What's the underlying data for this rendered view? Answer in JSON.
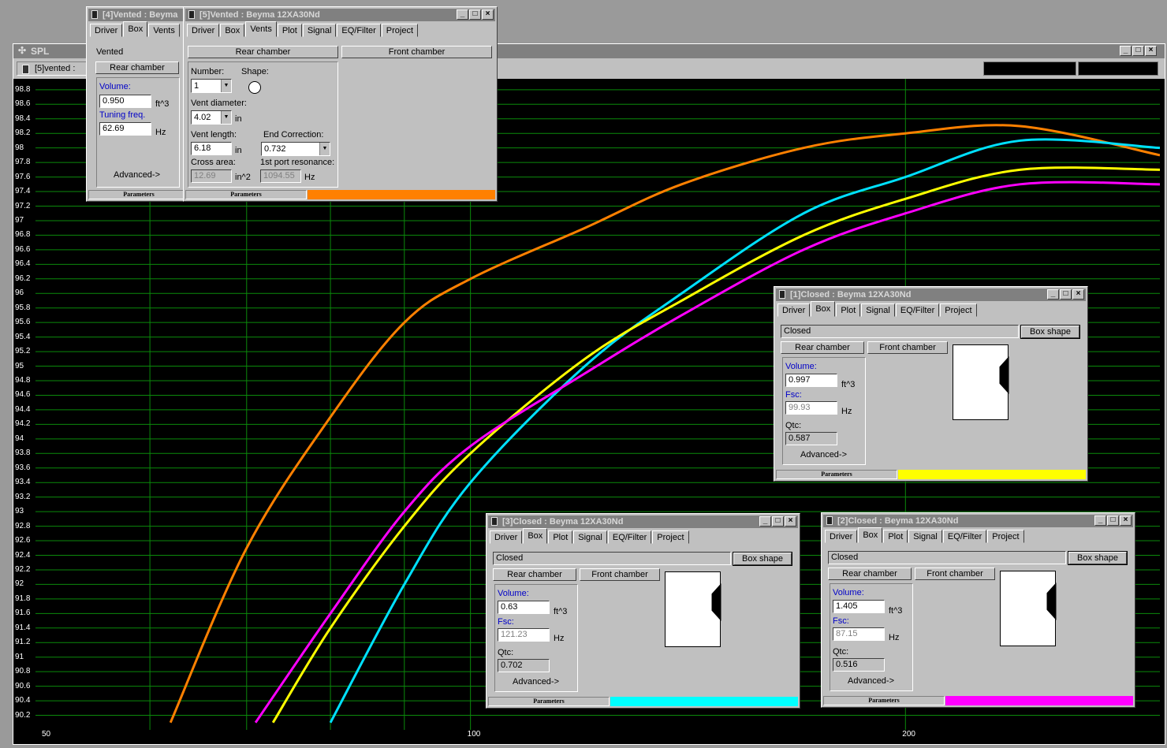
{
  "spl_window": {
    "title": "SPL",
    "toolbar_label": "[5]vented :",
    "y_ticks": [
      "98.8",
      "98.6",
      "98.4",
      "98.2",
      "98",
      "97.8",
      "97.6",
      "97.4",
      "97.2",
      "97",
      "96.8",
      "96.6",
      "96.4",
      "96.2",
      "96",
      "95.8",
      "95.6",
      "95.4",
      "95.2",
      "95",
      "94.8",
      "94.6",
      "94.4",
      "94.2",
      "94",
      "93.8",
      "93.6",
      "93.4",
      "93.2",
      "93",
      "92.8",
      "92.6",
      "92.4",
      "92.2",
      "92",
      "91.8",
      "91.6",
      "91.4",
      "91.2",
      "91",
      "90.8",
      "90.6",
      "90.4",
      "90.2"
    ],
    "x_ticks": [
      "50",
      "100",
      "200"
    ]
  },
  "chart_data": {
    "type": "line",
    "title": "SPL",
    "xlabel": "",
    "ylabel": "",
    "x_scale": "log",
    "xlim": [
      50,
      300
    ],
    "ylim": [
      90,
      99
    ],
    "grid": true,
    "series": [
      {
        "color": "#ff8000",
        "x": [
          62,
          70,
          80,
          90,
          100,
          120,
          140,
          170,
          200,
          240,
          300
        ],
        "y": [
          90.1,
          92.5,
          94.3,
          95.6,
          96.2,
          96.9,
          97.5,
          98.0,
          98.2,
          98.3,
          97.9
        ]
      },
      {
        "color": "#00e0ff",
        "x": [
          80,
          90,
          100,
          120,
          140,
          170,
          200,
          240,
          300
        ],
        "y": [
          90.1,
          92.0,
          93.4,
          95.0,
          96.0,
          97.1,
          97.6,
          98.1,
          98.0
        ]
      },
      {
        "color": "#ffff00",
        "x": [
          73,
          80,
          90,
          100,
          120,
          140,
          170,
          200,
          240,
          300
        ],
        "y": [
          90.1,
          91.4,
          92.8,
          93.8,
          95.1,
          95.9,
          96.8,
          97.3,
          97.7,
          97.7
        ]
      },
      {
        "color": "#ff00ff",
        "x": [
          71,
          80,
          90,
          100,
          120,
          140,
          170,
          200,
          240,
          300
        ],
        "y": [
          90.1,
          91.6,
          93.0,
          93.9,
          94.9,
          95.7,
          96.6,
          97.1,
          97.5,
          97.5
        ]
      }
    ]
  },
  "win4": {
    "title": "[4]Vented : Beyma",
    "tabs": [
      "Driver",
      "Box",
      "Vents"
    ],
    "type_value": "Vented",
    "rear_chamber": "Rear chamber",
    "volume_label": "Volume:",
    "volume_value": "0.950",
    "volume_unit": "ft^3",
    "tuning_label": "Tuning freq.",
    "tuning_value": "62.69",
    "tuning_unit": "Hz",
    "advanced": "Advanced->",
    "status": "Parameters"
  },
  "win5": {
    "title": "[5]Vented : Beyma 12XA30Nd",
    "tabs": [
      "Driver",
      "Box",
      "Vents",
      "Plot",
      "Signal",
      "EQ/Filter",
      "Project"
    ],
    "rear_chamber": "Rear chamber",
    "front_chamber": "Front chamber",
    "number_label": "Number:",
    "number_value": "1",
    "shape_label": "Shape:",
    "vent_diameter_label": "Vent diameter:",
    "vent_diameter_value": "4.02",
    "vent_diameter_unit": "in",
    "vent_length_label": "Vent length:",
    "vent_length_value": "6.18",
    "vent_length_unit": "in",
    "end_correction_label": "End Correction:",
    "end_correction_value": "0.732",
    "cross_area_label": "Cross area:",
    "cross_area_value": "12.69",
    "cross_area_unit": "in^2",
    "port_res_label": "1st port resonance:",
    "port_res_value": "1094.55",
    "port_res_unit": "Hz",
    "status": "Parameters",
    "color": "#ff8000"
  },
  "win1": {
    "title": "[1]Closed : Beyma 12XA30Nd",
    "tabs": [
      "Driver",
      "Box",
      "Plot",
      "Signal",
      "EQ/Filter",
      "Project"
    ],
    "type_value": "Closed",
    "box_shape": "Box shape",
    "rear_chamber": "Rear chamber",
    "front_chamber": "Front chamber",
    "volume_label": "Volume:",
    "volume_value": "0.997",
    "volume_unit": "ft^3",
    "fsc_label": "Fsc:",
    "fsc_value": "99.93",
    "fsc_unit": "Hz",
    "qtc_label": "Qtc:",
    "qtc_value": "0.587",
    "advanced": "Advanced->",
    "status": "Parameters",
    "color": "#ffff00"
  },
  "win3": {
    "title": "[3]Closed : Beyma 12XA30Nd",
    "tabs": [
      "Driver",
      "Box",
      "Plot",
      "Signal",
      "EQ/Filter",
      "Project"
    ],
    "type_value": "Closed",
    "box_shape": "Box shape",
    "rear_chamber": "Rear chamber",
    "front_chamber": "Front chamber",
    "volume_label": "Volume:",
    "volume_value": "0.63",
    "volume_unit": "ft^3",
    "fsc_label": "Fsc:",
    "fsc_value": "121.23",
    "fsc_unit": "Hz",
    "qtc_label": "Qtc:",
    "qtc_value": "0.702",
    "advanced": "Advanced->",
    "status": "Parameters",
    "color": "#00ffff"
  },
  "win2": {
    "title": "[2]Closed : Beyma 12XA30Nd",
    "tabs": [
      "Driver",
      "Box",
      "Plot",
      "Signal",
      "EQ/Filter",
      "Project"
    ],
    "type_value": "Closed",
    "box_shape": "Box shape",
    "rear_chamber": "Rear chamber",
    "front_chamber": "Front chamber",
    "volume_label": "Volume:",
    "volume_value": "1.405",
    "volume_unit": "ft^3",
    "fsc_label": "Fsc:",
    "fsc_value": "87.15",
    "fsc_unit": "Hz",
    "qtc_label": "Qtc:",
    "qtc_value": "0.516",
    "advanced": "Advanced->",
    "status": "Parameters",
    "color": "#ff00ff"
  }
}
